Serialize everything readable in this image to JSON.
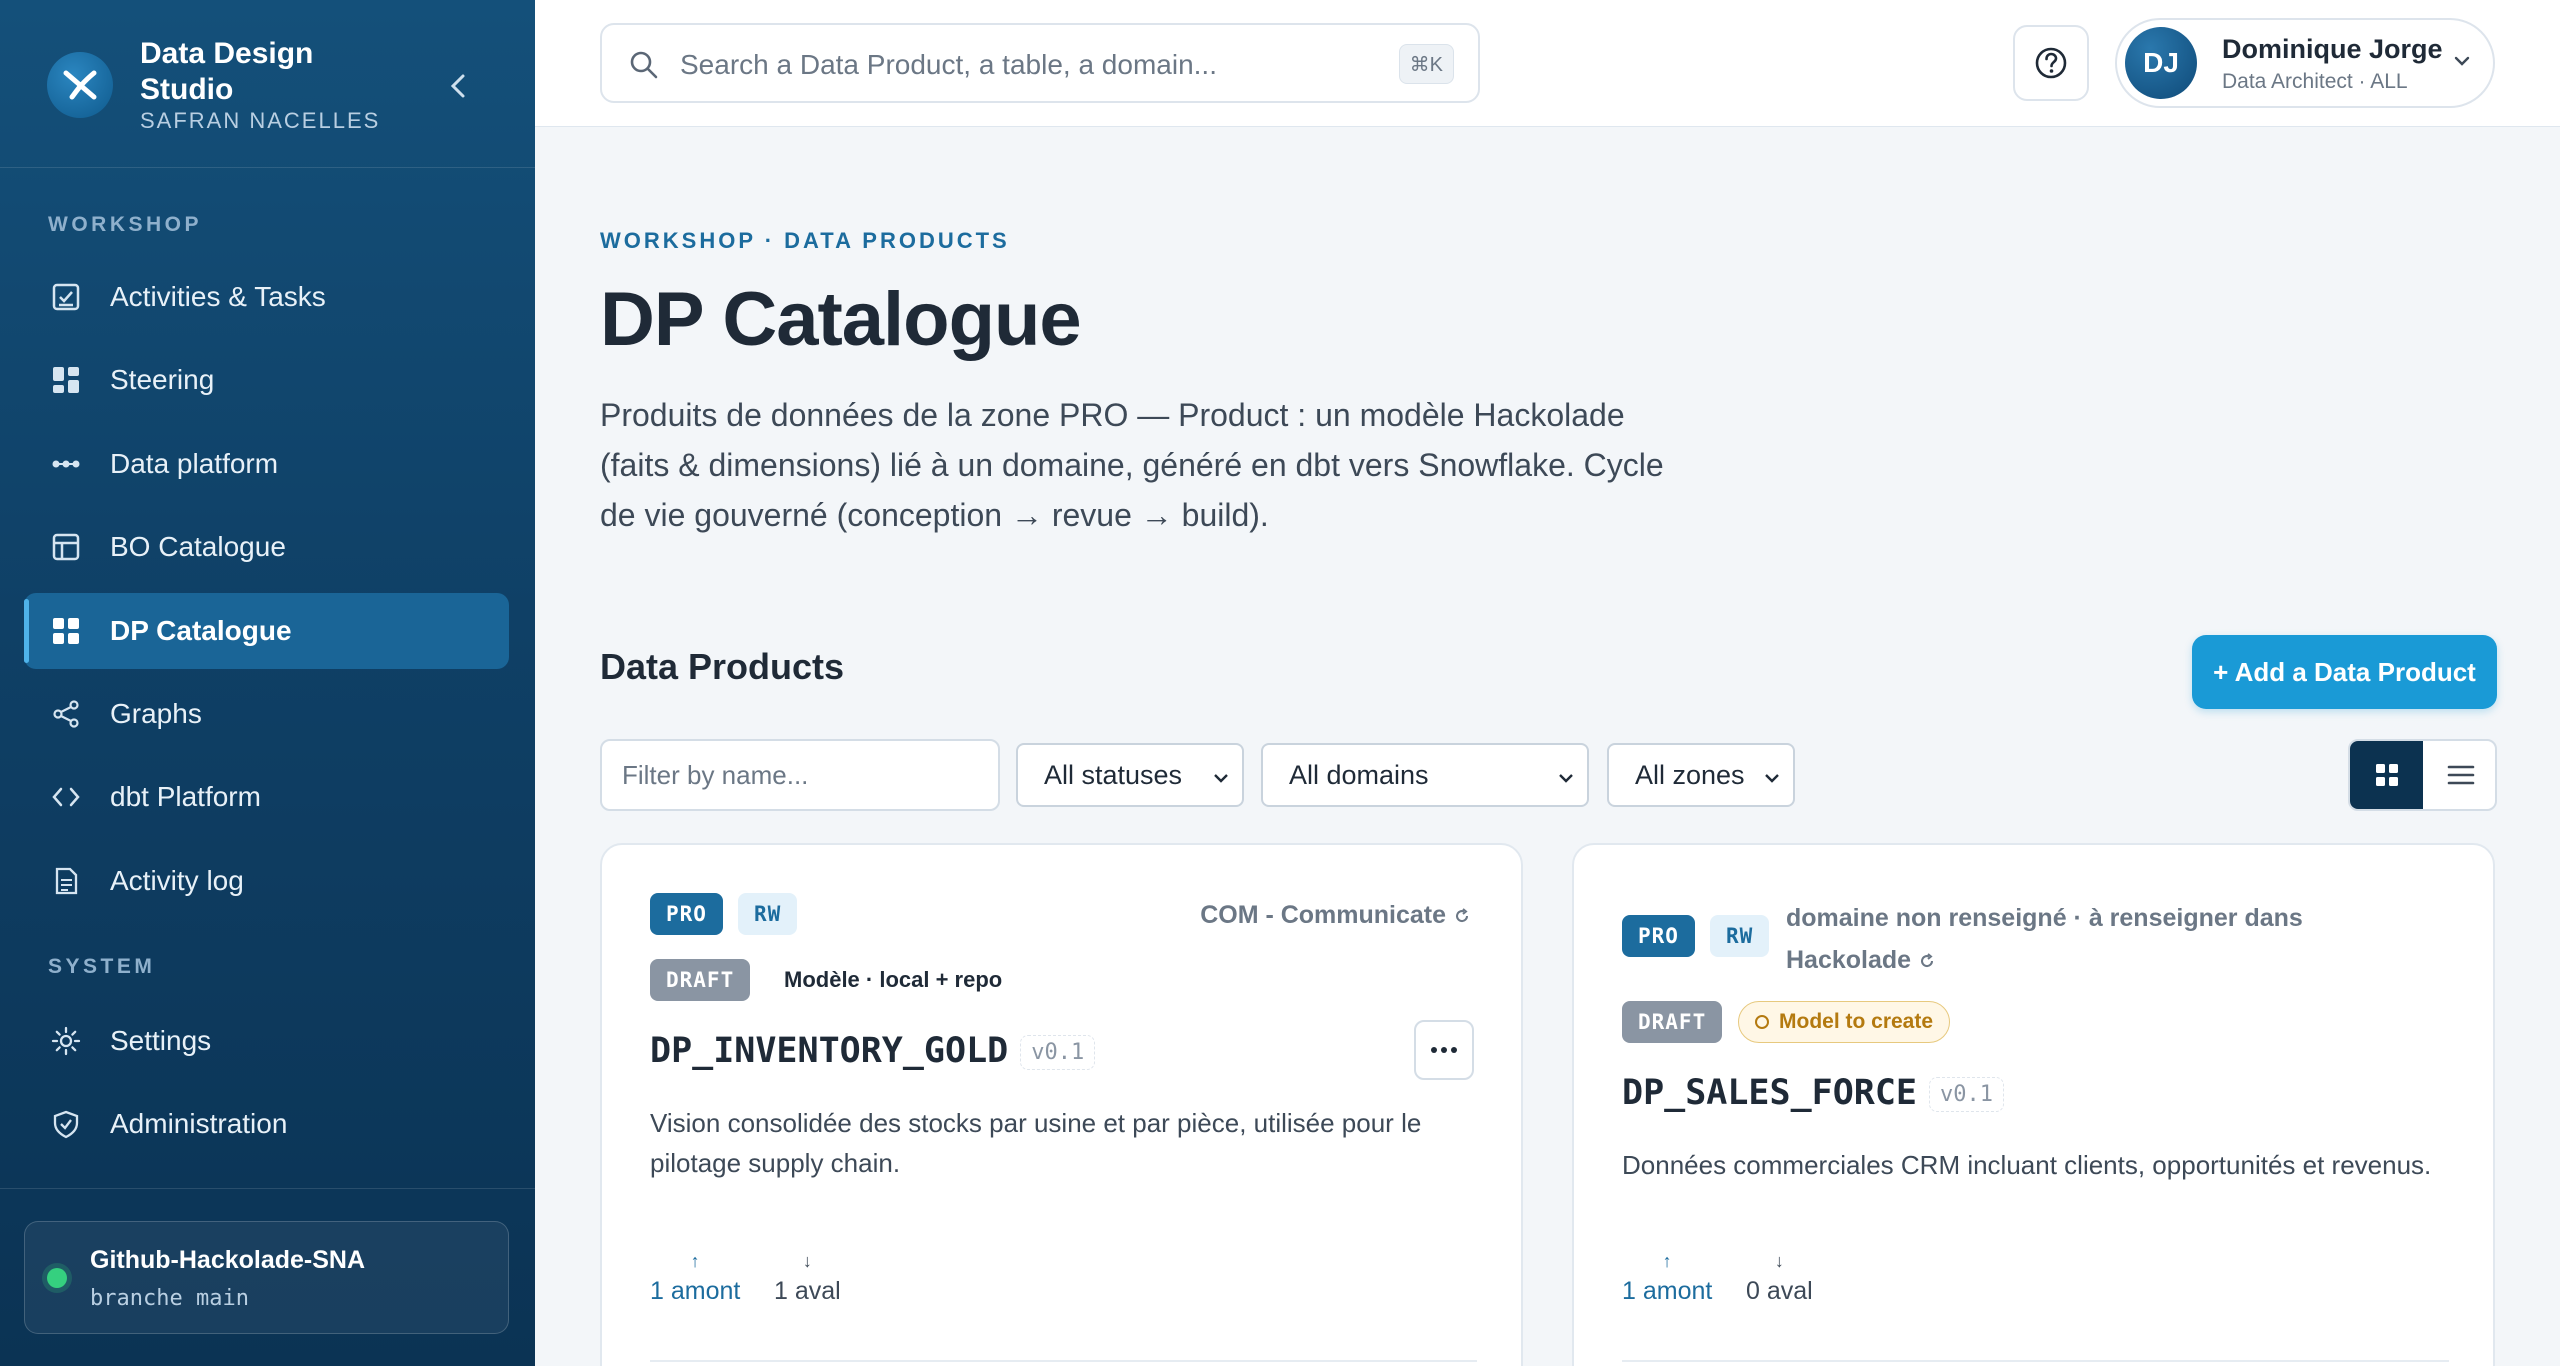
{
  "sidebar": {
    "brand_title": "Data Design Studio",
    "brand_subtitle": "SAFRAN NACELLES",
    "sections": {
      "workshop": "WORKSHOP",
      "system": "SYSTEM"
    },
    "items": [
      {
        "label": "Activities & Tasks",
        "icon": "checklist-icon"
      },
      {
        "label": "Steering",
        "icon": "dashboard-icon"
      },
      {
        "label": "Data platform",
        "icon": "pipeline-icon"
      },
      {
        "label": "BO Catalogue",
        "icon": "layout-icon"
      },
      {
        "label": "DP Catalogue",
        "icon": "grid-icon",
        "active": true
      },
      {
        "label": "Graphs",
        "icon": "share-icon"
      },
      {
        "label": "dbt Platform",
        "icon": "code-icon"
      },
      {
        "label": "Activity log",
        "icon": "document-icon"
      },
      {
        "label": "Settings",
        "icon": "sun-gear-icon"
      },
      {
        "label": "Administration",
        "icon": "shield-icon"
      }
    ],
    "repo": {
      "name": "Github-Hackolade-SNA",
      "branch": "branche main",
      "status_color": "#35d07f"
    }
  },
  "topbar": {
    "search_placeholder": "Search a Data Product, a table, a domain...",
    "shortcut": "⌘K",
    "user": {
      "initials": "DJ",
      "name": "Dominique Jorge",
      "role": "Data Architect · ALL"
    }
  },
  "main": {
    "breadcrumb": "WORKSHOP · DATA PRODUCTS",
    "title": "DP Catalogue",
    "description": "Produits de données de la zone PRO — Product : un modèle Hackolade (faits & dimensions) lié à un domaine, généré en dbt vers Snowflake. Cycle de vie gouverné (conception → revue → build).",
    "section_title": "Data Products",
    "add_button": "+ Add a Data Product",
    "filters": {
      "name_placeholder": "Filter by name...",
      "status": "All statuses",
      "domain": "All domains",
      "zone": "All zones"
    }
  },
  "cards": [
    {
      "zone": "PRO",
      "access": "RW",
      "domain": "COM - Communicate",
      "status": "DRAFT",
      "model_note": "Modèle · local + repo",
      "name": "DP_INVENTORY_GOLD",
      "version": "v0.1",
      "description": "Vision consolidée des stocks par usine et par pièce, utilisée pour le pilotage supply chain.",
      "upstream": "1 amont",
      "downstream": "1 aval"
    },
    {
      "zone": "PRO",
      "access": "RW",
      "domain": "domaine non renseigné · à renseigner dans Hackolade",
      "status": "DRAFT",
      "warning": "Model to create",
      "name": "DP_SALES_FORCE",
      "version": "v0.1",
      "description": "Données commerciales CRM incluant clients, opportunités et revenus.",
      "upstream": "1 amont",
      "downstream": "0 aval"
    }
  ],
  "colors": {
    "accent": "#1a9ad6",
    "sidebar": "#0f4066",
    "pro_tag": "#1c6c9e"
  }
}
